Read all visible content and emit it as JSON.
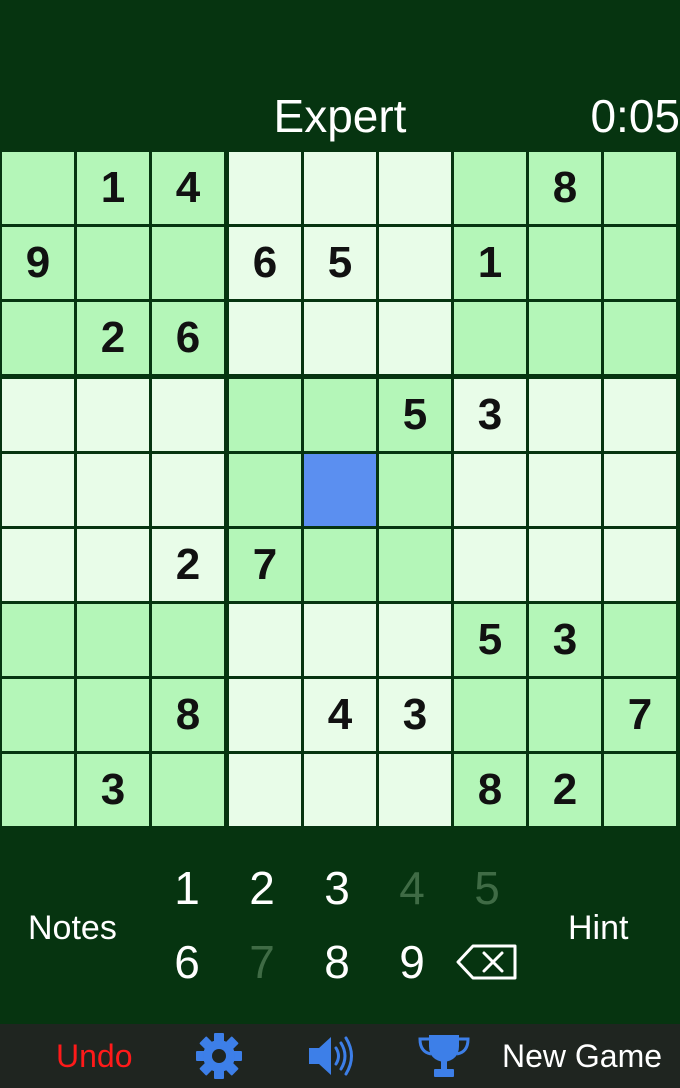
{
  "header": {
    "difficulty": "Expert",
    "timer": "0:05"
  },
  "board": {
    "selected": [
      4,
      4
    ],
    "cells": [
      [
        "",
        "1",
        "4",
        "",
        "",
        "",
        "",
        "8",
        ""
      ],
      [
        "9",
        "",
        "",
        "6",
        "5",
        "",
        "1",
        "",
        ""
      ],
      [
        "",
        "2",
        "6",
        "",
        "",
        "",
        "",
        "",
        ""
      ],
      [
        "",
        "",
        "",
        "",
        "",
        "5",
        "3",
        "",
        ""
      ],
      [
        "",
        "",
        "",
        "",
        "",
        "",
        "",
        "",
        ""
      ],
      [
        "",
        "",
        "2",
        "7",
        "",
        "",
        "",
        "",
        ""
      ],
      [
        "",
        "",
        "",
        "",
        "",
        "",
        "5",
        "3",
        ""
      ],
      [
        "",
        "",
        "8",
        "",
        "4",
        "3",
        "",
        "",
        "7"
      ],
      [
        "",
        "3",
        "",
        "",
        "",
        "",
        "8",
        "2",
        ""
      ]
    ],
    "colors": {
      "dark_box": "#b4f6b8",
      "light_box": "#e8fce8",
      "selected": "#5b8ff0"
    }
  },
  "numpad": {
    "notes_label": "Notes",
    "hint_label": "Hint",
    "numbers": [
      {
        "label": "1",
        "enabled": true
      },
      {
        "label": "2",
        "enabled": true
      },
      {
        "label": "3",
        "enabled": true
      },
      {
        "label": "4",
        "enabled": false
      },
      {
        "label": "5",
        "enabled": false
      },
      {
        "label": "6",
        "enabled": true
      },
      {
        "label": "7",
        "enabled": false
      },
      {
        "label": "8",
        "enabled": true
      },
      {
        "label": "9",
        "enabled": true
      }
    ],
    "erase_icon": "backspace-icon"
  },
  "toolbar": {
    "undo_label": "Undo",
    "settings_icon": "gear-icon",
    "sound_icon": "speaker-icon",
    "trophy_icon": "trophy-icon",
    "new_game_label": "New Game",
    "icon_color": "#3d7fe8",
    "undo_color": "#ff1a1a"
  }
}
